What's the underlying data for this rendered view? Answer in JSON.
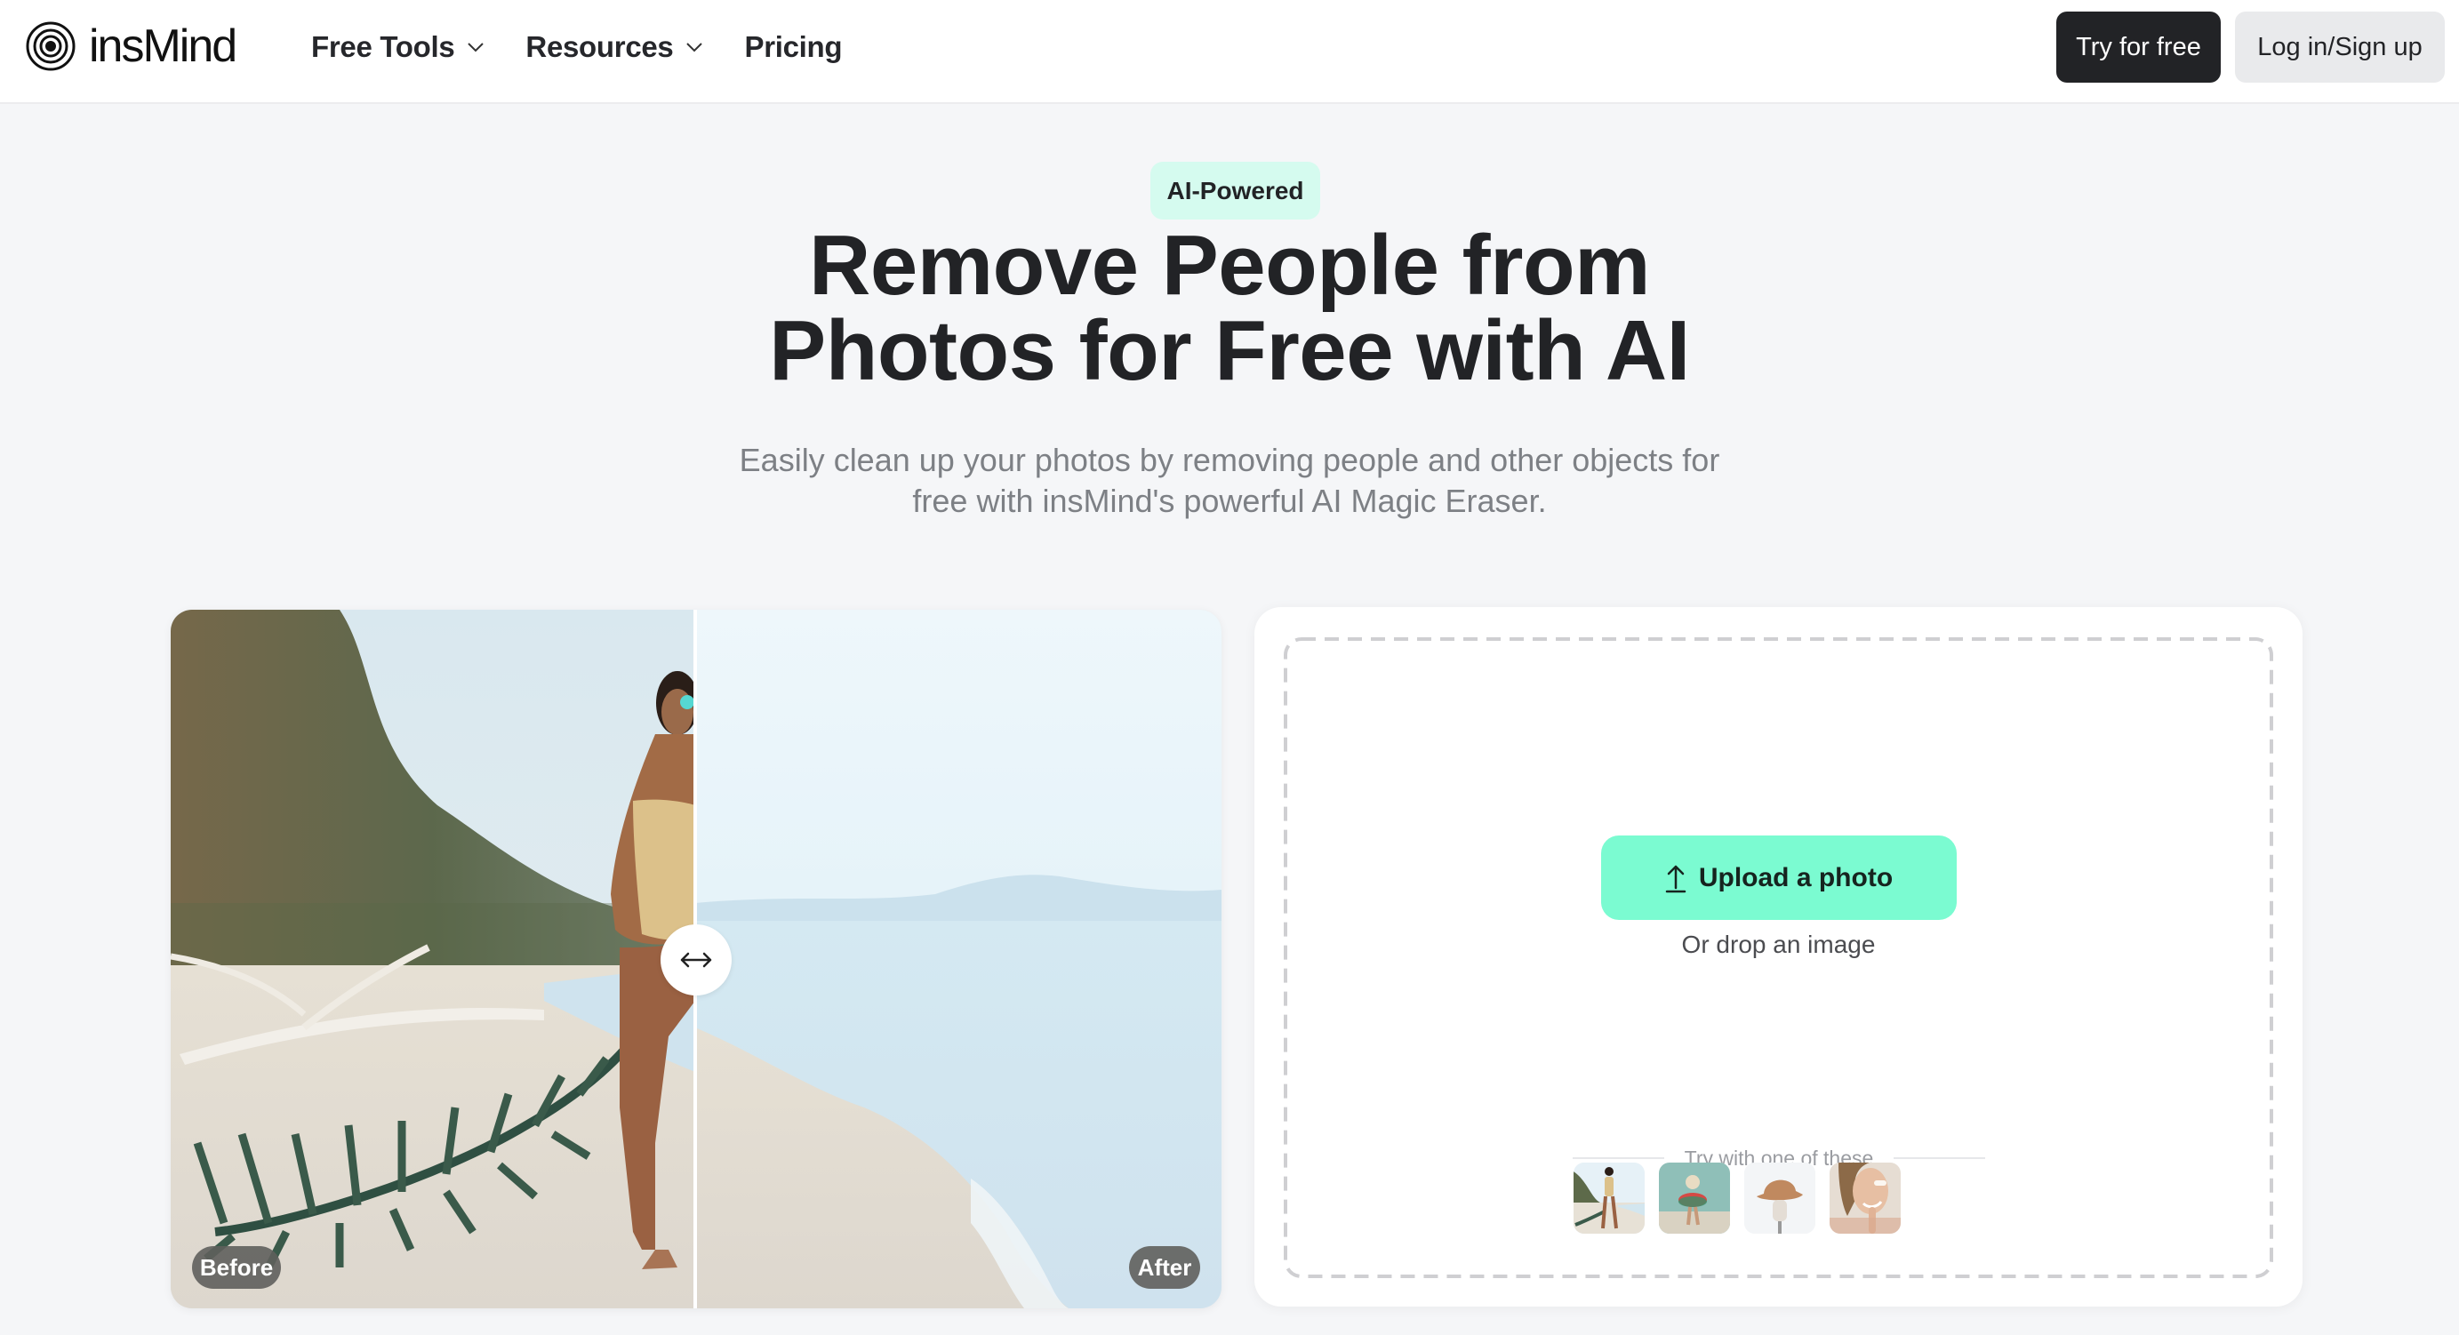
{
  "header": {
    "brand": "insMind",
    "nav": [
      {
        "label": "Free Tools",
        "has_dropdown": true
      },
      {
        "label": "Resources",
        "has_dropdown": true
      },
      {
        "label": "Pricing",
        "has_dropdown": false
      }
    ],
    "try_button": "Try for free",
    "login_button": "Log in/Sign up"
  },
  "hero": {
    "badge": "AI-Powered",
    "title_lines": [
      "Remove People from",
      "Photos for Free with AI"
    ],
    "subtitle_lines": [
      "Easily clean up your photos by removing people and other objects for",
      "free with insMind's powerful AI Magic Eraser."
    ]
  },
  "compare": {
    "before_label": "Before",
    "after_label": "After",
    "handle_icon": "left-right-arrow-icon",
    "split_position": 0.5
  },
  "upload": {
    "button_label": "Upload a photo",
    "button_icon": "upload-arrow-icon",
    "drop_text": "Or drop an image",
    "samples_label": "Try with one of these",
    "samples": [
      {
        "subject": "woman on beach with palm leaf"
      },
      {
        "subject": "child with swim ring at sea"
      },
      {
        "subject": "bucket hat on mannequin"
      },
      {
        "subject": "smiling woman applying cream"
      }
    ]
  },
  "colors": {
    "accent": "#7bfbd1",
    "badge_bg": "#d5fbef",
    "dark": "#222326",
    "page_bg": "#f5f6f8"
  }
}
